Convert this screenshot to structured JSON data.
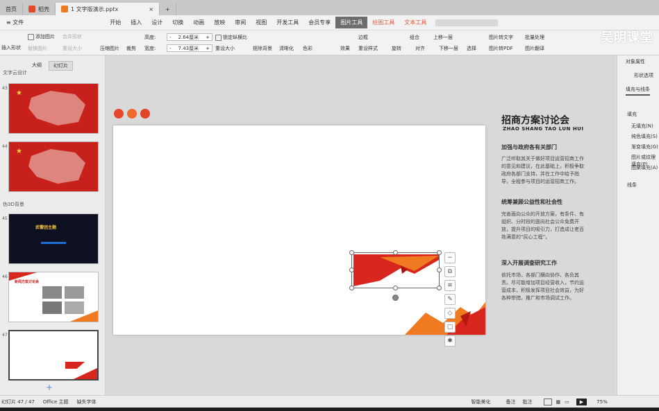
{
  "tabs": {
    "home": "首页",
    "wps": "稻壳",
    "doc": "1 文字版演示.pptx",
    "add": "+"
  },
  "menu": {
    "file": "≡ 文件",
    "items": [
      "开始",
      "插入",
      "设计",
      "切换",
      "动画",
      "放映",
      "审阅",
      "视图",
      "开发工具",
      "会员专享"
    ],
    "picture_tools": "图片工具",
    "drawing_tools": "绘图工具",
    "text_tools": "文本工具"
  },
  "ribbon": {
    "insert_shape": "插入形状",
    "add_picture": "添加图片",
    "combine_shape": "合并形状",
    "replace_picture": "替换图片",
    "reset_picture": "重设大小",
    "compress": "压缩图片",
    "crop": "裁剪",
    "height_label": "高度:",
    "height_value": "2.64厘米",
    "width_label": "宽度:",
    "width_value": "7.43厘米",
    "lock_ratio": "锁定纵横比",
    "reset_size": "重设大小",
    "matting": "抠除背景",
    "clarity": "清晰化",
    "color": "色彩",
    "effect": "效果",
    "reset_style": "重设样式",
    "border": "边框",
    "group": "组合",
    "up_layer": "上移一层",
    "down_layer": "下移一层",
    "rotate": "旋转",
    "align": "对齐",
    "select": "选择",
    "pic_to_text": "图片转文字",
    "batch": "批量处理",
    "pic_to_pdf": "图片转PDF",
    "pic_translate": "图片翻译"
  },
  "brand": "吴明课堂",
  "left_panel": {
    "tab_outline": "大纲",
    "tab_slides": "幻灯片",
    "section1": "文字云设计",
    "section2": "伪3D背景",
    "slides": [
      {
        "num": "43"
      },
      {
        "num": "44"
      },
      {
        "num": "45"
      },
      {
        "num": "46"
      },
      {
        "num": "47"
      }
    ],
    "thumb45_title": "武警团主题",
    "thumb46_title": "新闻方案讨论会",
    "add_slide": "+"
  },
  "slide_text": {
    "title": "招商方案讨论会",
    "subtitle": "ZHAO SHANG TAO LUN HUI",
    "h1": "加强与政府各有关部门",
    "p1": "广泛听取其关于做好项目运营招商工作的意见和建议，在此基础上，积极争取政府各部门支持，并在工作中给予指导，全程参与项目的运营招商工作。",
    "h2": "统筹兼顾公益性和社会性",
    "p2": "完善面向公众的开放方案，有条件、有组织、分时段的面向社会公众免费开放，提升项目的吸引力，打造成让老百姓满意的“民心工程”。",
    "h3": "深入开展调查研究工作",
    "p3": "依托市场，各部门横向协作、各负其责。尽可能增加项目经营收入，节约运营成本，积极发挥项目社会效益，为好各种举措，推广和市场调试工作。"
  },
  "right_panel": {
    "title": "对象属性",
    "tab_shape": "形状选项",
    "tab_fill": "填充与线条",
    "fill": "填充",
    "options": [
      "无填充(N)",
      "纯色填充(S)",
      "渐变填充(G)",
      "图片或纹理填充(P)",
      "图案填充(A)"
    ],
    "line": "线条"
  },
  "status": {
    "slide_count": "幻灯片 47 / 47",
    "theme": "Office 主题",
    "missing_font": "缺失字体",
    "smart_beautify": "智能美化",
    "notes": "备注",
    "comments": "批注",
    "zoom": "75%"
  },
  "colors": {
    "accent_red": "#d8261e",
    "accent_orange": "#f07a22",
    "dark_thumb": "#0d1020"
  }
}
